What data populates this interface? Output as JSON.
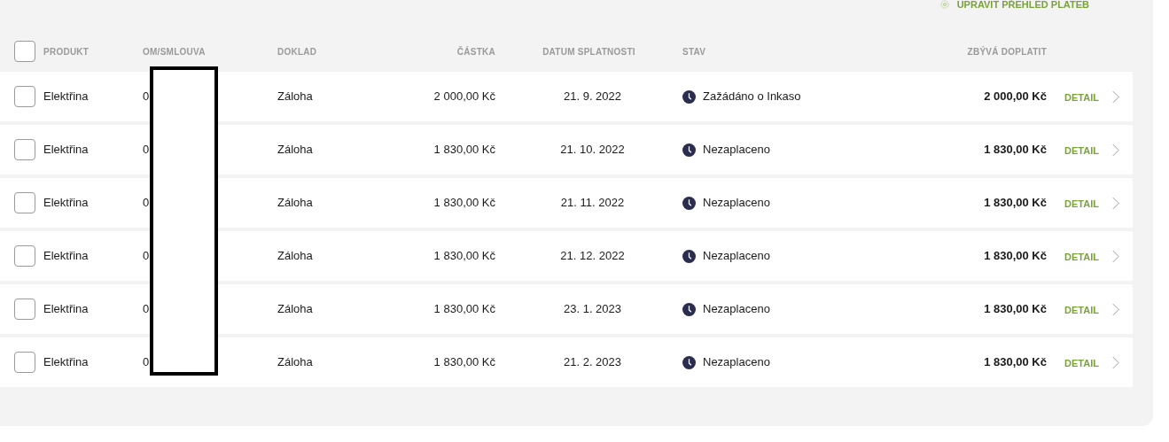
{
  "edit_link": "UPRAVIT PŘEHLED PLATEB",
  "select_all": {
    "checked": false
  },
  "columns": [
    "PRODUKT",
    "OM/SMLOUVA",
    "DOKLAD",
    "ČÁSTKA",
    "DATUM SPLATNOSTI",
    "STAV",
    "ZBÝVÁ DOPLATIT"
  ],
  "rows": [
    {
      "checked": false,
      "product": "Elektřina",
      "om": "0",
      "document": "Záloha",
      "amount": "2 000,00 Kč",
      "due_date": "21. 9. 2022",
      "status": "Zažádáno o Inkaso",
      "remaining": "2 000,00 Kč",
      "action": "DETAIL"
    },
    {
      "checked": false,
      "product": "Elektřina",
      "om": "0",
      "document": "Záloha",
      "amount": "1 830,00 Kč",
      "due_date": "21. 10. 2022",
      "status": "Nezaplaceno",
      "remaining": "1 830,00 Kč",
      "action": "DETAIL"
    },
    {
      "checked": false,
      "product": "Elektřina",
      "om": "0",
      "document": "Záloha",
      "amount": "1 830,00 Kč",
      "due_date": "21. 11. 2022",
      "status": "Nezaplaceno",
      "remaining": "1 830,00 Kč",
      "action": "DETAIL"
    },
    {
      "checked": false,
      "product": "Elektřina",
      "om": "0",
      "document": "Záloha",
      "amount": "1 830,00 Kč",
      "due_date": "21. 12. 2022",
      "status": "Nezaplaceno",
      "remaining": "1 830,00 Kč",
      "action": "DETAIL"
    },
    {
      "checked": false,
      "product": "Elektřina",
      "om": "0",
      "document": "Záloha",
      "amount": "1 830,00 Kč",
      "due_date": "23. 1. 2023",
      "status": "Nezaplaceno",
      "remaining": "1 830,00 Kč",
      "action": "DETAIL"
    },
    {
      "checked": false,
      "product": "Elektřina",
      "om": "0",
      "document": "Záloha",
      "amount": "1 830,00 Kč",
      "due_date": "21. 2. 2023",
      "status": "Nezaplaceno",
      "remaining": "1 830,00 Kč",
      "action": "DETAIL"
    }
  ]
}
